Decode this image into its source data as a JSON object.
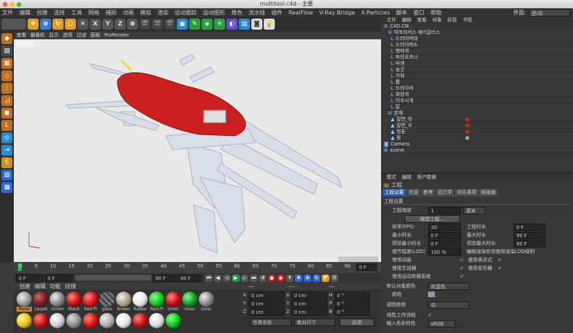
{
  "window": {
    "title": "multitool.c4d - 主要"
  },
  "menubar": [
    "文件",
    "编辑",
    "创建",
    "选择",
    "工具",
    "网格",
    "捕捉",
    "动画",
    "模拟",
    "渲染",
    "运动跟踪",
    "运动图形",
    "角色",
    "流水线",
    "插件",
    "RealFlow",
    "V-Ray Bridge",
    "X-Particles",
    "脚本",
    "窗口",
    "帮助"
  ],
  "interface": {
    "label": "界面:",
    "value": "启动"
  },
  "toolbar": {
    "x": "X",
    "y": "Y",
    "z": "Z"
  },
  "viewport": {
    "menu": [
      "查看",
      "摄像机",
      "显示",
      "选项",
      "过滤",
      "面板",
      "ProRender"
    ]
  },
  "timeline": {
    "ticks": [
      "0",
      "5",
      "10",
      "15",
      "20",
      "25",
      "30",
      "35",
      "40",
      "45",
      "50",
      "55",
      "60",
      "65",
      "70",
      "75",
      "80",
      "85",
      "90"
    ],
    "frame_display": "0 F"
  },
  "transport": {
    "start": "0 F",
    "current": "0 F",
    "end_a": "90 F",
    "end_b": "90 F"
  },
  "materials": {
    "menu": [
      "创建",
      "编辑",
      "功能",
      "纹理"
    ],
    "items": [
      {
        "name": "Metal",
        "color": "#9a9a9a"
      },
      {
        "name": "carpai",
        "color": "#7a2020"
      },
      {
        "name": "chrom",
        "color": "#8a8a8a"
      },
      {
        "name": "Black",
        "color": "#cc1010"
      },
      {
        "name": "Red Pl",
        "color": "#dd1515"
      },
      {
        "name": "glass",
        "color": "#5a5a5a"
      },
      {
        "name": "Brown",
        "color": "#b0a48a"
      },
      {
        "name": "Rubbe",
        "color": "#e8e8e8"
      },
      {
        "name": "Red Pl",
        "color": "#11cc22"
      },
      {
        "name": "inner",
        "color": "#cc1010"
      },
      {
        "name": "inner",
        "color": "#1a9a2a"
      },
      {
        "name": "inner",
        "color": "#8a8a8a"
      }
    ],
    "row2": [
      "#e8c020",
      "#cc1010",
      "#d0d0d0",
      "#909090",
      "#dd1515",
      "#b0b0b0",
      "#e8e8e8",
      "#cc1010",
      "#ddd",
      "#11cc22"
    ]
  },
  "coords": {
    "labels": [
      "---",
      "---",
      "---"
    ],
    "rows": [
      {
        "a": "X",
        "av": "0 cm",
        "b": "X",
        "bv": "0 cm",
        "c": "H",
        "cv": "0 °"
      },
      {
        "a": "Y",
        "av": "0 cm",
        "b": "Y",
        "bv": "0 cm",
        "c": "P",
        "cv": "0 °"
      },
      {
        "a": "Z",
        "av": "0 cm",
        "b": "Z",
        "bv": "0 cm",
        "c": "B",
        "cv": "0 °"
      }
    ],
    "mode": "世界坐标",
    "scale": "绝对尺寸",
    "apply": "应用"
  },
  "objects": {
    "tabs": [
      "文件",
      "编辑",
      "查看",
      "对象",
      "标签",
      "书签"
    ],
    "items": [
      "C4D.CN",
      "박포지커스 에키글라스",
      "드라이버대",
      "드라이버소",
      "병따개",
      "파인오프너",
      "따개",
      "송곳",
      "가위",
      "톱",
      "드라이버",
      "확장개",
      "이쑤시개",
      "칼",
      "본체",
      "칼면_하",
      "칼면_우",
      "빗톤",
      "핑",
      "Camera",
      "scene"
    ]
  },
  "attributes": {
    "menu": [
      "模式",
      "编辑",
      "用户数据"
    ],
    "section": "工程",
    "tabs": [
      "工程设置",
      "信息",
      "参考",
      "动力学",
      "待办事项",
      "帧插值"
    ],
    "group": "工程设置",
    "scale_label": "工程缩放",
    "scale_value": "1",
    "scale_unit": "厘米",
    "scale_btn": "缩放工程...",
    "fps_label": "帧率(FPS)",
    "fps_value": "30",
    "proj_time_label": "工程时长",
    "proj_time_value": "0 F",
    "min_label": "最小时长",
    "min_value": "0 F",
    "max_label": "最大时长",
    "max_value": "90 F",
    "pmin_label": "预览最小时长",
    "pmin_value": "0 F",
    "pmax_label": "预览最大时长",
    "pmax_value": "90 F",
    "lod_label": "细节程度(LOD)",
    "lod_value": "100 %",
    "lod_render": "编辑渲染检视使用渲染LOD级别",
    "checks": [
      "使用动画",
      "使用表达式",
      "使用生成器",
      "使用变形器",
      "使用运动剪辑系统"
    ],
    "default_color_label": "默认对象颜色",
    "default_color_value": "灰蓝色",
    "color_label": "颜色",
    "view_clip_label": "视图修剪",
    "view_clip_value": "中",
    "linear_label": "线性工作流程",
    "input_color_label": "输入色彩特性",
    "input_color_value": "sRGB"
  }
}
